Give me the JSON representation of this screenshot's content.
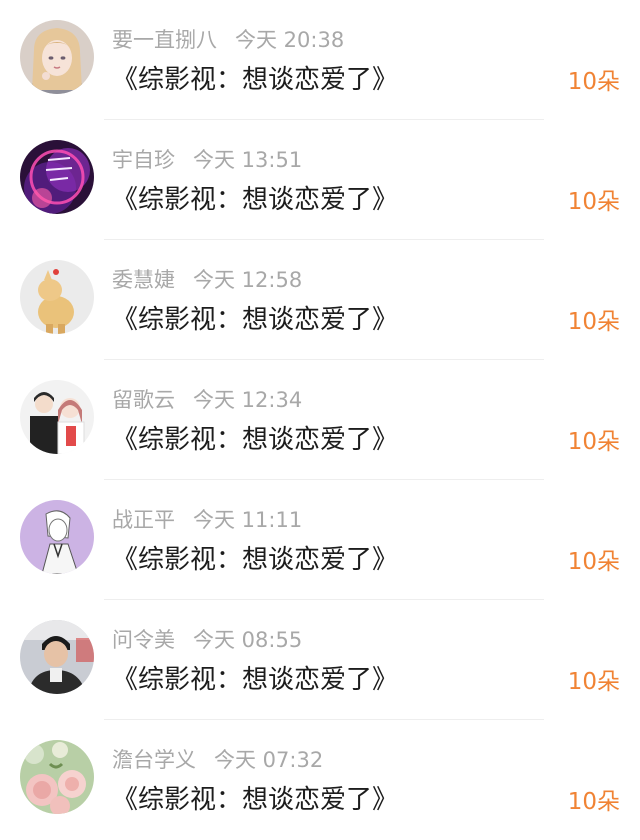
{
  "records": [
    {
      "user": "要一直捌八",
      "time": "今天 20:38",
      "title": "《综影视：想谈恋爱了》",
      "amount": "10朵",
      "avatar_icon": "avatar-anime-girl-icon"
    },
    {
      "user": "宇自珍",
      "time": "今天 13:51",
      "title": "《综影视：想谈恋爱了》",
      "amount": "10朵",
      "avatar_icon": "avatar-neon-text-icon"
    },
    {
      "user": "委慧婕",
      "time": "今天 12:58",
      "title": "《综影视：想谈恋爱了》",
      "amount": "10朵",
      "avatar_icon": "avatar-figurine-icon"
    },
    {
      "user": "留歌云",
      "time": "今天 12:34",
      "title": "《综影视：想谈恋爱了》",
      "amount": "10朵",
      "avatar_icon": "avatar-couple-icon"
    },
    {
      "user": "战正平",
      "time": "今天 11:11",
      "title": "《综影视：想谈恋爱了》",
      "amount": "10朵",
      "avatar_icon": "avatar-sketch-icon"
    },
    {
      "user": "问令美",
      "time": "今天 08:55",
      "title": "《综影视：想谈恋爱了》",
      "amount": "10朵",
      "avatar_icon": "avatar-person-icon"
    },
    {
      "user": "澹台学义",
      "time": "今天 07:32",
      "title": "《综影视：想谈恋爱了》",
      "amount": "10朵",
      "avatar_icon": "avatar-roses-icon"
    }
  ],
  "colors": {
    "accent": "#f08334",
    "meta_text": "#a8a8a8",
    "title_text": "#1d1d1d",
    "divider": "#eeeeee"
  }
}
